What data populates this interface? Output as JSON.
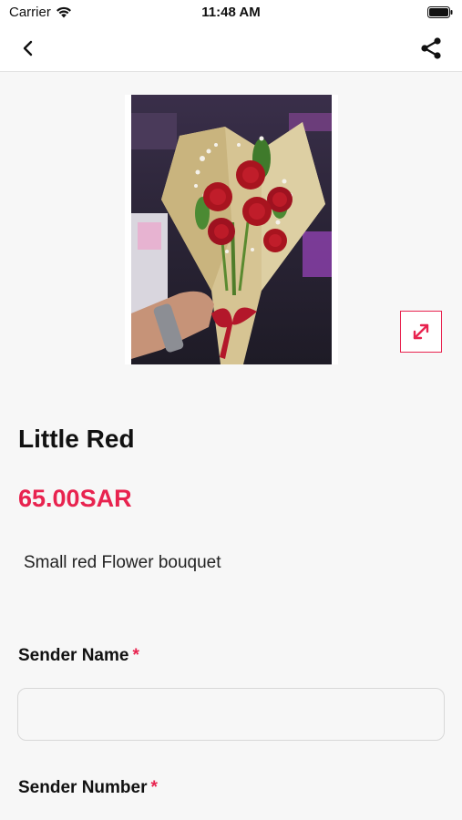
{
  "status_bar": {
    "carrier": "Carrier",
    "time": "11:48 AM",
    "wifi_icon": "wifi-icon",
    "battery_icon": "battery-icon"
  },
  "navbar": {
    "back_icon": "chevron-left-icon",
    "share_icon": "share-icon"
  },
  "product": {
    "image_alt": "red-rose-bouquet-photo",
    "expand_icon": "expand-icon",
    "title": "Little Red",
    "price": "65.00SAR",
    "description": "Small red Flower bouquet"
  },
  "form": {
    "sender_name_label": "Sender Name",
    "sender_name_value": "",
    "sender_number_label": "Sender Number",
    "required_marker": "*"
  },
  "colors": {
    "accent": "#e8234f",
    "background": "#f7f7f7",
    "navbar": "#ffffff"
  }
}
